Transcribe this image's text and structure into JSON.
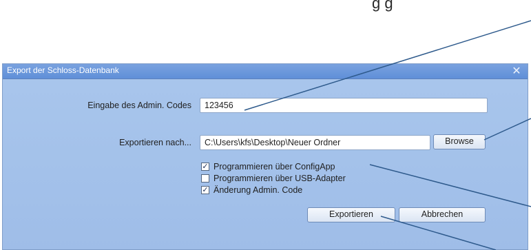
{
  "caption": {
    "text": "g              g"
  },
  "dialog": {
    "title": "Export der Schloss-Datenbank",
    "close_symbol": "✕",
    "admin_code": {
      "label": "Eingabe des Admin. Codes",
      "value": "123456"
    },
    "export_path": {
      "label": "Exportieren nach...",
      "value": "C:\\Users\\kfs\\Desktop\\Neuer Ordner",
      "browse_label": "Browse"
    },
    "options": [
      {
        "label": "Programmieren über ConfigApp",
        "checked": true
      },
      {
        "label": "Programmieren über USB-Adapter",
        "checked": false
      },
      {
        "label": "Änderung Admin. Code",
        "checked": true
      }
    ],
    "export_label": "Exportieren",
    "cancel_label": "Abbrechen"
  },
  "colors": {
    "dialog_background": "#a3c1ea",
    "titlebar": "#6a97da",
    "callout_line": "#2e5a8c"
  }
}
